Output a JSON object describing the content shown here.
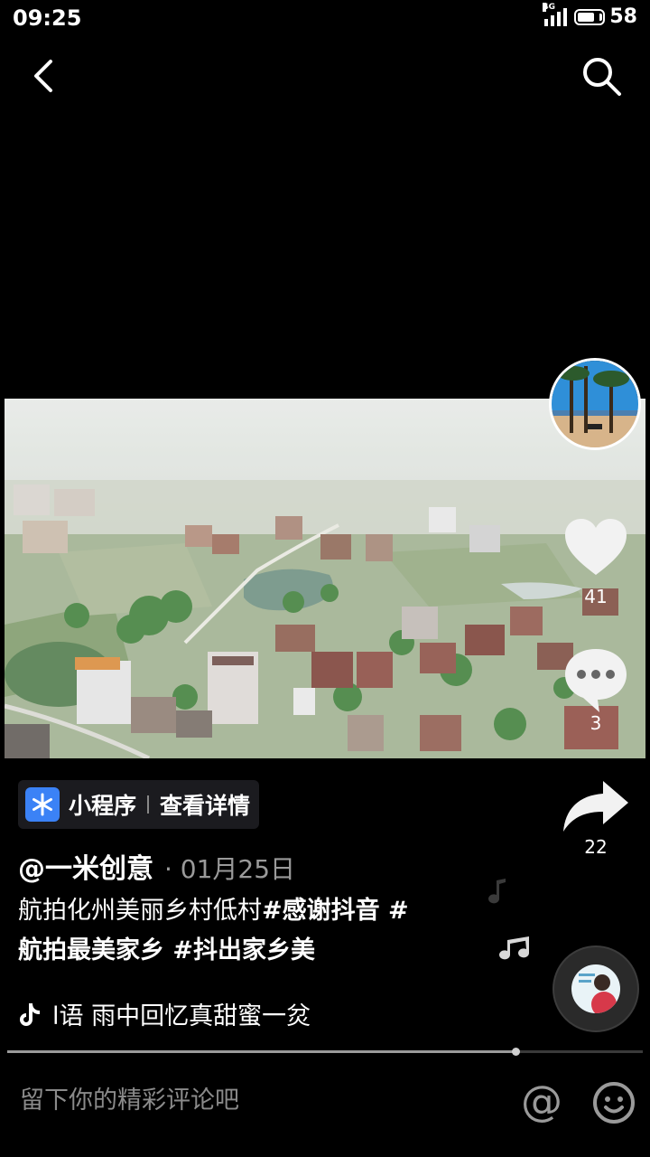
{
  "status": {
    "time": "09:25",
    "network": "4G",
    "battery": "58"
  },
  "video": {
    "colors": {
      "sky": "#dfe4e1",
      "field": "#8aa377",
      "tree": "#3c8a3c",
      "roof": "#7a3b2e",
      "pond": "#5f8a72"
    }
  },
  "rail": {
    "likes": "41",
    "comments": "3",
    "shares": "22"
  },
  "mini_program": {
    "label": "小程序",
    "detail": "查看详情",
    "icon": "snowflake-icon",
    "color": "#3b82f6"
  },
  "post": {
    "author": "@一米创意",
    "date": "· 01月25日",
    "caption_text": "航拍化州美丽乡村低村",
    "tags": [
      "#感谢抖音 #",
      "航拍最美家乡 #抖出家乡美"
    ]
  },
  "music": {
    "icon": "tiktok-note-icon",
    "title": "l语    雨中回忆真甜蜜一炃"
  },
  "progress": {
    "fraction": 0.8
  },
  "comment": {
    "placeholder": "留下你的精彩评论吧"
  }
}
